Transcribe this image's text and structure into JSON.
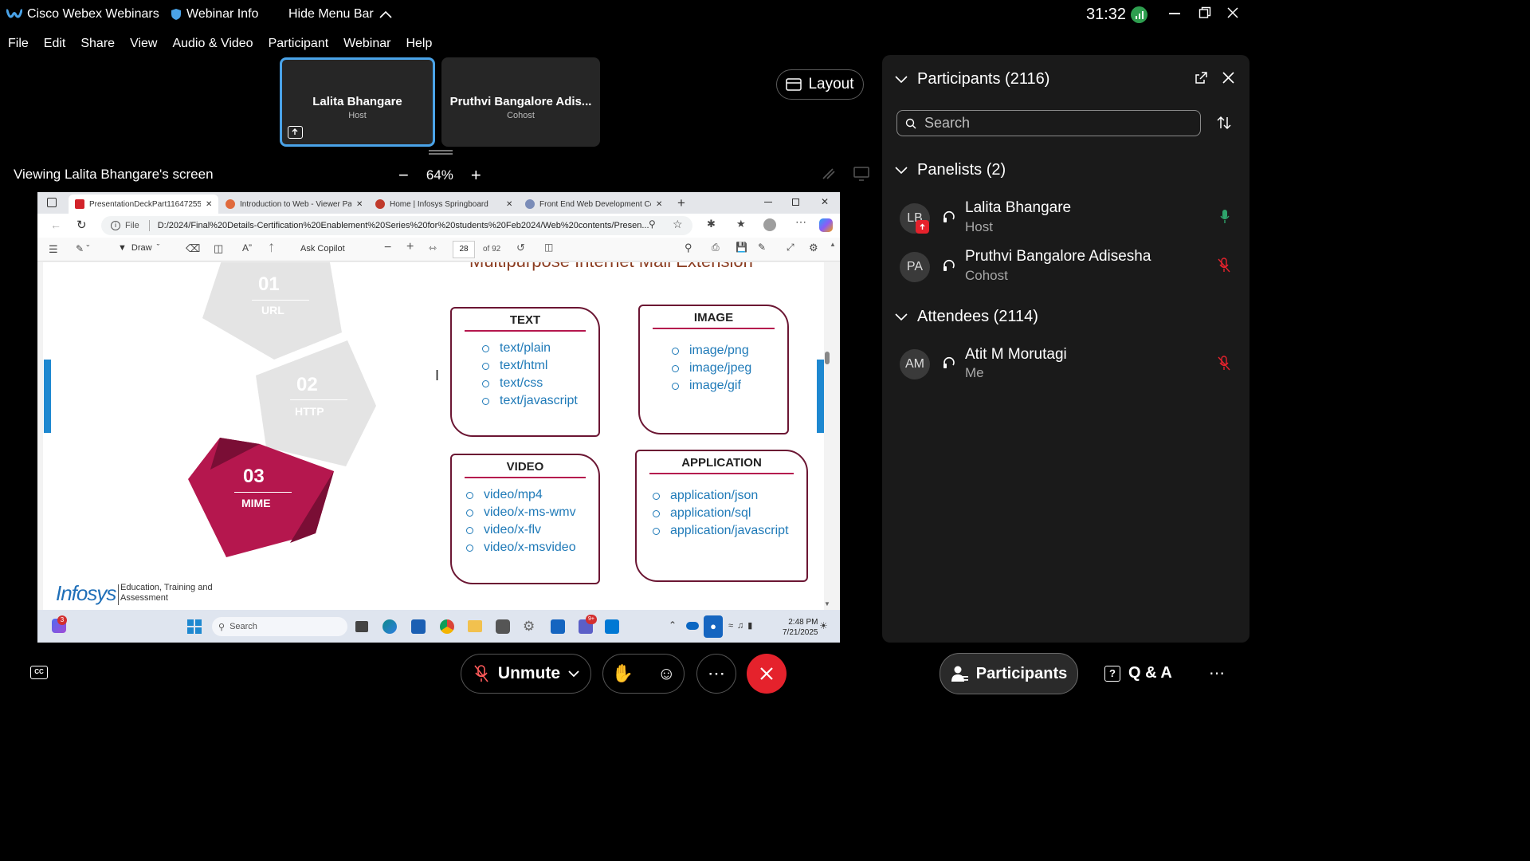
{
  "app": {
    "title": "Cisco Webex Webinars",
    "webinar_info": "Webinar Info",
    "hide_menu": "Hide Menu Bar",
    "timer": "31:32"
  },
  "menu": [
    "File",
    "Edit",
    "Share",
    "View",
    "Audio & Video",
    "Participant",
    "Webinar",
    "Help"
  ],
  "tiles": [
    {
      "name": "Lalita Bhangare",
      "role": "Host"
    },
    {
      "name": "Pruthvi Bangalore Adis...",
      "role": "Cohost"
    }
  ],
  "share": {
    "viewing": "Viewing Lalita Bhangare's screen",
    "zoom": "64%",
    "layout": "Layout"
  },
  "browser": {
    "tabs": [
      "PresentationDeckPart11647255",
      "Introduction to Web - Viewer Pag",
      "Home | Infosys Springboard",
      "Front End Web Development Cer"
    ],
    "address_scheme": "File",
    "address": "D:/2024/Final%20Details-Certification%20Enablement%20Series%20for%20students%20Feb2024/Web%20contents/Presen...",
    "pdf": {
      "draw": "Draw",
      "ask": "Ask Copilot",
      "page": "28",
      "of": "of 92"
    }
  },
  "slide": {
    "partial_title": "Multipurpose Internet Mail Extension",
    "steps": [
      {
        "num": "01",
        "label": "URL"
      },
      {
        "num": "02",
        "label": "HTTP"
      },
      {
        "num": "03",
        "label": "MIME"
      }
    ],
    "cards": [
      {
        "title": "TEXT",
        "items": [
          "text/plain",
          "text/html",
          "text/css",
          "text/javascript"
        ]
      },
      {
        "title": "IMAGE",
        "items": [
          "image/png",
          "image/jpeg",
          "image/gif"
        ]
      },
      {
        "title": "VIDEO",
        "items": [
          "video/mp4",
          "video/x-ms-wmv",
          "video/x-flv",
          "video/x-msvideo"
        ]
      },
      {
        "title": "APPLICATION",
        "items": [
          "application/json",
          "application/sql",
          "application/javascript"
        ]
      }
    ],
    "logo": "Infosys",
    "logo_sub1": "Education, Training and",
    "logo_sub2": "Assessment"
  },
  "taskbar": {
    "search": "Search",
    "time": "2:48 PM",
    "date": "7/21/2025",
    "badge1": "3",
    "badge2": "9+"
  },
  "panel": {
    "title": "Participants (2116)",
    "search_placeholder": "Search",
    "panelists_header": "Panelists (2)",
    "attendees_header": "Attendees (2114)",
    "panelists": [
      {
        "initials": "LB",
        "name": "Lalita Bhangare",
        "role": "Host"
      },
      {
        "initials": "PA",
        "name": "Pruthvi Bangalore Adisesha",
        "role": "Cohost"
      }
    ],
    "attendees": [
      {
        "initials": "AM",
        "name": "Atit M Morutagi",
        "role": "Me"
      }
    ]
  },
  "bottom": {
    "unmute": "Unmute",
    "participants": "Participants",
    "qa": "Q & A"
  },
  "colors": {
    "accent_blue": "#4aa3e8",
    "end_red": "#e5222c",
    "mime_red": "#b5174e",
    "link_blue": "#1f7ab8"
  }
}
